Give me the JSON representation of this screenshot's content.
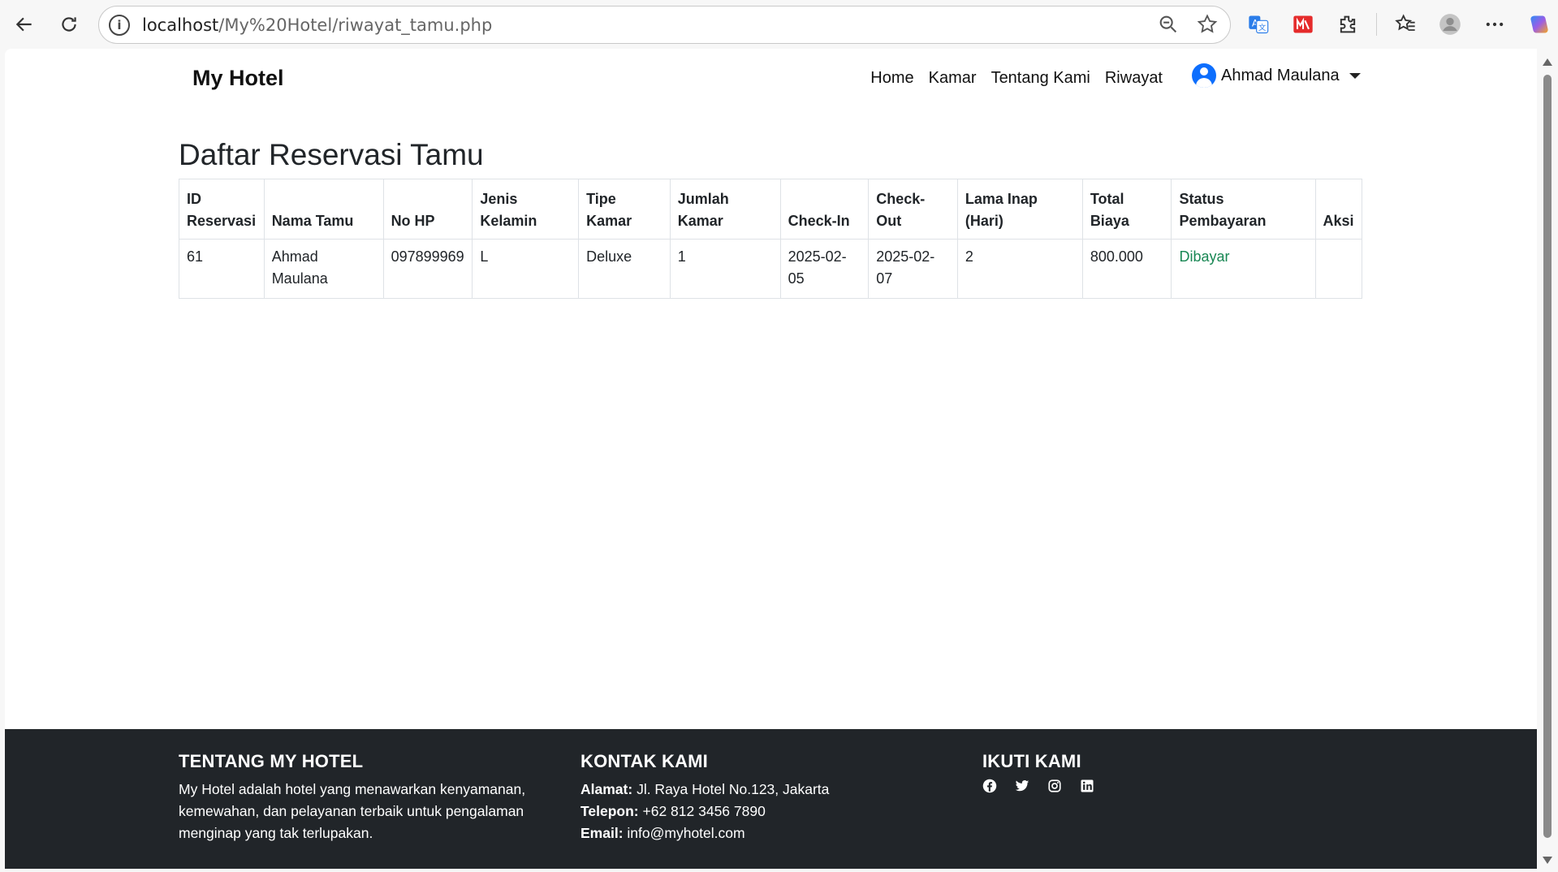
{
  "browser": {
    "url_host": "localhost",
    "url_path": "/My%20Hotel/riwayat_tamu.php"
  },
  "navbar": {
    "brand": "My Hotel",
    "links": [
      "Home",
      "Kamar",
      "Tentang Kami",
      "Riwayat"
    ],
    "user_name": "Ahmad Maulana"
  },
  "main": {
    "title": "Daftar Reservasi Tamu",
    "table": {
      "headers": [
        "ID Reservasi",
        "Nama Tamu",
        "No HP",
        "Jenis Kelamin",
        "Tipe Kamar",
        "Jumlah Kamar",
        "Check-In",
        "Check-Out",
        "Lama Inap (Hari)",
        "Total Biaya",
        "Status Pembayaran",
        "Aksi"
      ],
      "rows": [
        [
          "61",
          "Ahmad Maulana",
          "097899969",
          "L",
          "Deluxe",
          "1",
          "2025-02-05",
          "2025-02-07",
          "2",
          "800.000",
          "Dibayar",
          ""
        ]
      ]
    }
  },
  "footer": {
    "about_title": "TENTANG MY HOTEL",
    "about_text": "My Hotel adalah hotel yang menawarkan kenyamanan, kemewahan, dan pelayanan terbaik untuk pengalaman menginap yang tak terlupakan.",
    "contact_title": "KONTAK KAMI",
    "address_label": "Alamat:",
    "address_value": "Jl. Raya Hotel No.123, Jakarta",
    "phone_label": "Telepon:",
    "phone_value": "+62 812 3456 7890",
    "email_label": "Email:",
    "email_value": "info@myhotel.com",
    "follow_title": "IKUTI KAMI",
    "social_icons": [
      "facebook-icon",
      "twitter-icon",
      "instagram-icon",
      "linkedin-icon"
    ]
  },
  "colors": {
    "footer_bg": "#212529",
    "status_paid": "#198754",
    "avatar": "#0d6efd"
  }
}
